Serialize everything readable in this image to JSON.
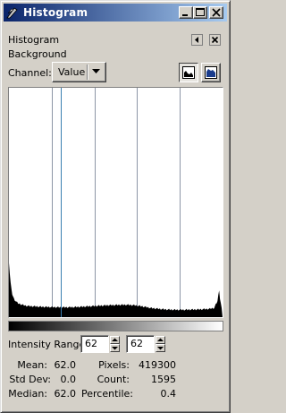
{
  "window": {
    "title": "Histogram",
    "icon": "tool-feather-icon"
  },
  "titlebar_buttons": [
    "minimize-icon",
    "maximize-icon",
    "close-icon"
  ],
  "panel": {
    "header": "Histogram",
    "layer": "Background",
    "controls": [
      "menu-arrow-icon",
      "panel-close-icon"
    ]
  },
  "channel": {
    "label": "Channel:",
    "selected": "Value"
  },
  "view_modes": [
    {
      "name": "linear-histogram-icon",
      "active": true
    },
    {
      "name": "logarithmic-histogram-icon",
      "active": false
    }
  ],
  "intensity_range": {
    "label": "Intensity Range:",
    "low": "62",
    "high": "62"
  },
  "stats": {
    "mean_label": "Mean:",
    "mean": "62.0",
    "stddev_label": "Std Dev:",
    "stddev": "0.0",
    "median_label": "Median:",
    "median": "62.0",
    "pixels_label": "Pixels:",
    "pixels": "419300",
    "count_label": "Count:",
    "count": "1595",
    "percentile_label": "Percentile:",
    "percentile": "0.4"
  },
  "colors": {
    "titlebar_start": "#0a246a",
    "titlebar_end": "#a6caf0",
    "face": "#d4d0c8",
    "selection_line": "#3a7fb0",
    "grid_line": "#8c96a6"
  },
  "histogram": {
    "bins_visible": 256,
    "selected_value": 62,
    "profile": [
      [
        0,
        0.24
      ],
      [
        1,
        0.19
      ],
      [
        2,
        0.15
      ],
      [
        3,
        0.12
      ],
      [
        4,
        0.1
      ],
      [
        6,
        0.08
      ],
      [
        8,
        0.07
      ],
      [
        11,
        0.06
      ],
      [
        15,
        0.055
      ],
      [
        20,
        0.05
      ],
      [
        25,
        0.048
      ],
      [
        30,
        0.047
      ],
      [
        40,
        0.045
      ],
      [
        50,
        0.044
      ],
      [
        60,
        0.043
      ],
      [
        70,
        0.043
      ],
      [
        80,
        0.044
      ],
      [
        90,
        0.046
      ],
      [
        100,
        0.048
      ],
      [
        110,
        0.05
      ],
      [
        120,
        0.052
      ],
      [
        130,
        0.053
      ],
      [
        140,
        0.054
      ],
      [
        150,
        0.052
      ],
      [
        160,
        0.047
      ],
      [
        170,
        0.04
      ],
      [
        180,
        0.036
      ],
      [
        190,
        0.033
      ],
      [
        200,
        0.032
      ],
      [
        210,
        0.032
      ],
      [
        220,
        0.033
      ],
      [
        230,
        0.034
      ],
      [
        240,
        0.036
      ],
      [
        246,
        0.04
      ],
      [
        250,
        0.07
      ],
      [
        252,
        0.12
      ],
      [
        253,
        0.08
      ],
      [
        255,
        0.04
      ]
    ]
  }
}
